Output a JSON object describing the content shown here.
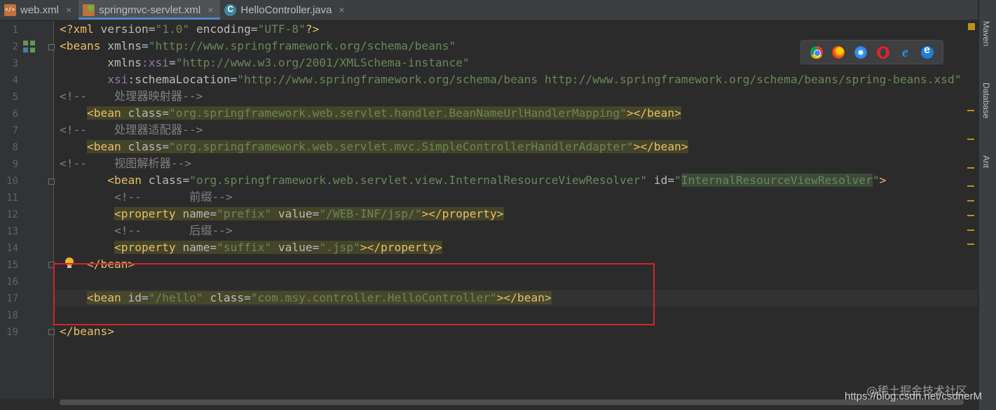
{
  "tabs": [
    {
      "label": "web.xml",
      "icon": "xml-file-icon",
      "active": false
    },
    {
      "label": "springmvc-servlet.xml",
      "icon": "spring-xml-file-icon",
      "active": true
    },
    {
      "label": "HelloController.java",
      "icon": "java-class-icon",
      "active": false
    }
  ],
  "tab_close_glyph": "×",
  "line_numbers": [
    "1",
    "2",
    "3",
    "4",
    "5",
    "6",
    "7",
    "8",
    "9",
    "10",
    "11",
    "12",
    "13",
    "14",
    "15",
    "16",
    "17",
    "18",
    "19"
  ],
  "code": {
    "l1": {
      "t1": "<?",
      "t2": "xml ",
      "a1": "version",
      "eq1": "=",
      "v1": "\"1.0\"",
      "sp": " ",
      "a2": "encoding",
      "eq2": "=",
      "v2": "\"UTF-8\"",
      "t3": "?>"
    },
    "l2": {
      "t1": "<beans ",
      "a1": "xmlns",
      "eq": "=",
      "v1": "\"http://www.springframework.org/schema/beans\""
    },
    "l3": {
      "indent": "       ",
      "a1": "xmlns",
      "ns": ":xsi",
      "eq": "=",
      "v1": "\"http://www.w3.org/2001/XMLSchema-instance\""
    },
    "l4": {
      "indent": "       ",
      "ns": "xsi",
      "a1": ":schemaLocation",
      "eq": "=",
      "v1": "\"http://www.springframework.org/schema/beans http://www.springframework.org/schema/beans/spring-beans.xsd\""
    },
    "l5": {
      "c": "<!--    处理器映射器-->"
    },
    "l6": {
      "indent": "    ",
      "t1": "<bean ",
      "a1": "class",
      "eq": "=",
      "v1": "\"org.springframework.web.servlet.handler.BeanNameUrlHandlerMapping\"",
      "t2": "></bean>"
    },
    "l7": {
      "c": "<!--    处理器适配器-->"
    },
    "l8": {
      "indent": "    ",
      "t1": "<bean ",
      "a1": "class",
      "eq": "=",
      "v1": "\"org.springframework.web.servlet.mvc.SimpleControllerHandlerAdapter\"",
      "t2": "></bean>"
    },
    "l9": {
      "c": "<!--    视图解析器-->"
    },
    "l10": {
      "indent": "       ",
      "t1": "<bean ",
      "a1": "class",
      "eq": "=",
      "v1": "\"org.springframework.web.servlet.view.InternalResourceViewResolver\"",
      "sp": " ",
      "a2": "id",
      "eq2": "=",
      "q1": "\"",
      "v2": "InternalResourceViewResolver",
      "q2": "\"",
      "t2": ">"
    },
    "l11": {
      "indent": "        ",
      "c": "<!--       前缀-->"
    },
    "l12": {
      "indent": "        ",
      "t1": "<property ",
      "a1": "name",
      "eq": "=",
      "v1": "\"prefix\"",
      "sp": " ",
      "a2": "value",
      "eq2": "=",
      "v2": "\"/WEB-INF/jsp/\"",
      "t2": "></property>"
    },
    "l13": {
      "indent": "        ",
      "c": "<!--       后缀-->"
    },
    "l14": {
      "indent": "        ",
      "t1": "<property ",
      "a1": "name",
      "eq": "=",
      "v1": "\"suffix\"",
      "sp": " ",
      "a2": "value",
      "eq2": "=",
      "v2": "\".jsp\"",
      "t2": "></property>"
    },
    "l15": {
      "indent": "    ",
      "t1": "</bean>"
    },
    "l17": {
      "indent": "    ",
      "t1": "<bean ",
      "a1": "id",
      "eq": "=",
      "v1": "\"/hello\"",
      "sp": " ",
      "a2": "class",
      "eq2": "=",
      "v2": "\"com.msy.controller.HelloController\"",
      "t2": "></bean>"
    },
    "l19": {
      "t1": "</beans>"
    }
  },
  "right_tool_tabs": [
    "Maven",
    "Database",
    "Ant"
  ],
  "browser_icons": [
    "chrome-icon",
    "firefox-icon",
    "safari-icon",
    "opera-icon",
    "internet-explorer-icon",
    "edge-icon"
  ],
  "ie_glyph": "e",
  "watermark": {
    "cn": "@稀土掘金技术社区",
    "url": "https://blog.csdn.net/csdnerM"
  },
  "colors": {
    "tag": "#e8bf6a",
    "attr": "#bababa",
    "value": "#6a8759",
    "comment": "#808080",
    "highlight_box": "#d3242b"
  }
}
